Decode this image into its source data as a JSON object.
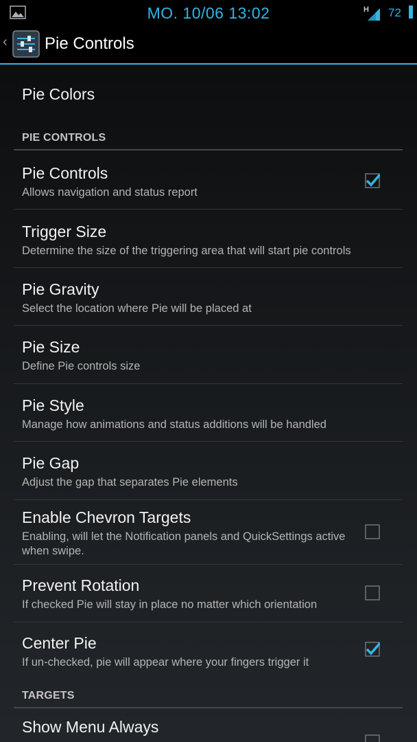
{
  "status_bar": {
    "clock": "MO. 10/06 13:02",
    "network_type": "H",
    "battery_level": "72",
    "accent_color": "#33b5e5"
  },
  "action_bar": {
    "back_glyph": "‹",
    "icon": "sliders-icon",
    "title": "Pie Controls"
  },
  "preferences": [
    {
      "title": "Pie Colors"
    },
    {
      "category": "PIE CONTROLS"
    },
    {
      "title": "Pie Controls",
      "summary": "Allows navigation and status report",
      "checked": true
    },
    {
      "title": "Trigger Size",
      "summary": "Determine the size of the triggering area that will start pie controls"
    },
    {
      "title": "Pie Gravity",
      "summary": "Select the location where Pie will be placed at"
    },
    {
      "title": "Pie Size",
      "summary": "Define Pie controls size"
    },
    {
      "title": "Pie Style",
      "summary": "Manage how animations and status additions will be handled"
    },
    {
      "title": "Pie Gap",
      "summary": "Adjust the gap that separates Pie elements"
    },
    {
      "title": "Enable Chevron Targets",
      "summary": "Enabling, will let the Notification panels and QuickSettings active when swipe.",
      "checked": false
    },
    {
      "title": "Prevent Rotation",
      "summary": "If checked Pie will stay in place no matter which orientation",
      "checked": false
    },
    {
      "title": "Center Pie",
      "summary": "If un-checked, pie will appear where your fingers trigger it",
      "checked": true
    },
    {
      "category": "TARGETS"
    },
    {
      "title": "Show Menu Always",
      "checked": false
    }
  ]
}
